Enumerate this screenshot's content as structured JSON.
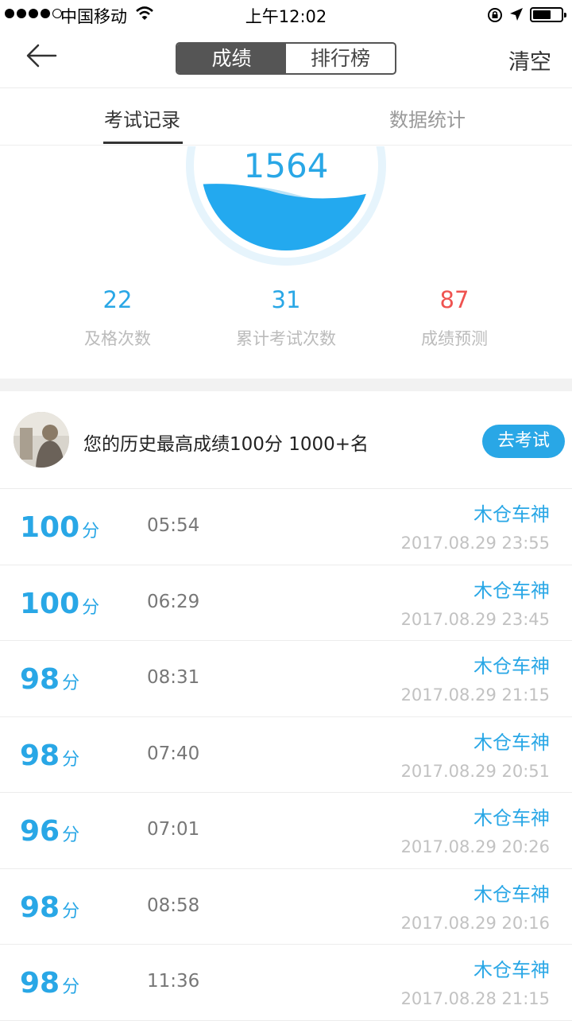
{
  "status_bar": {
    "carrier": "中国移动",
    "time": "上午12:02"
  },
  "nav": {
    "segments": [
      "成绩",
      "排行榜"
    ],
    "active_segment": 0,
    "clear_label": "清空"
  },
  "tabs": [
    "考试记录",
    "数据统计"
  ],
  "gauge": {
    "value": "1564"
  },
  "stats": [
    {
      "value": "22",
      "label": "及格次数"
    },
    {
      "value": "31",
      "label": "累计考试次数"
    },
    {
      "value": "87",
      "label": "成绩预测"
    }
  ],
  "best": {
    "text": "您的历史最高成绩100分 1000+名",
    "button": "去考试"
  },
  "score_unit": "分",
  "records": [
    {
      "score": "100",
      "duration": "05:54",
      "name": "木仓车神",
      "time": "2017.08.29 23:55"
    },
    {
      "score": "100",
      "duration": "06:29",
      "name": "木仓车神",
      "time": "2017.08.29 23:45"
    },
    {
      "score": "98",
      "duration": "08:31",
      "name": "木仓车神",
      "time": "2017.08.29 21:15"
    },
    {
      "score": "98",
      "duration": "07:40",
      "name": "木仓车神",
      "time": "2017.08.29 20:51"
    },
    {
      "score": "96",
      "duration": "07:01",
      "name": "木仓车神",
      "time": "2017.08.29 20:26"
    },
    {
      "score": "98",
      "duration": "08:58",
      "name": "木仓车神",
      "time": "2017.08.29 20:16"
    },
    {
      "score": "98",
      "duration": "11:36",
      "name": "木仓车神",
      "time": "2017.08.28 21:15"
    }
  ],
  "colors": {
    "accent": "#29a7e6",
    "red": "#ef5350"
  }
}
